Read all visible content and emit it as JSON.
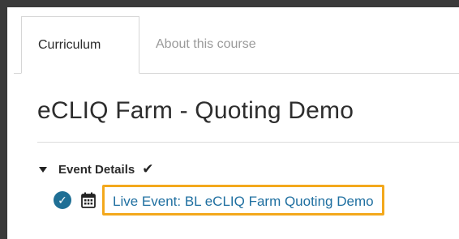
{
  "tabs": [
    {
      "label": "Curriculum",
      "active": true
    },
    {
      "label": "About this course",
      "active": false
    }
  ],
  "course_title": "eCLIQ Farm - Quoting Demo",
  "section": {
    "title": "Event Details",
    "expanded": true,
    "completed": true
  },
  "items": [
    {
      "label": "Live Event: BL eCLIQ Farm Quoting Demo",
      "completed": true,
      "type_icon": "calendar-icon"
    }
  ],
  "colors": {
    "accent": "#1f6f95",
    "link": "#1f6fa0",
    "highlight": "#f3a81c"
  }
}
